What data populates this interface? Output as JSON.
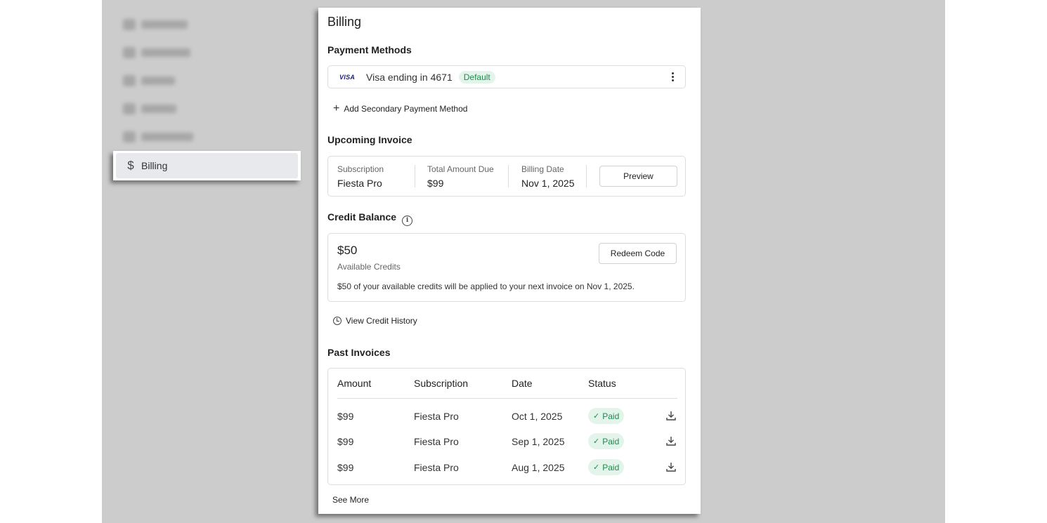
{
  "sidebar": {
    "billing_label": "Billing"
  },
  "panel": {
    "title": "Billing"
  },
  "payment_methods": {
    "title": "Payment Methods",
    "card_brand": "VISA",
    "card_label": "Visa ending in 4671",
    "default_badge": "Default",
    "add_label": "Add Secondary Payment Method"
  },
  "upcoming_invoice": {
    "title": "Upcoming Invoice",
    "subscription_label": "Subscription",
    "subscription_value": "Fiesta Pro",
    "amount_label": "Total Amount Due",
    "amount_value": "$99",
    "date_label": "Billing Date",
    "date_value": "Nov 1, 2025",
    "preview_label": "Preview"
  },
  "credit_balance": {
    "title": "Credit Balance",
    "amount": "$50",
    "sub": "Available Credits",
    "redeem_label": "Redeem Code",
    "note": "$50 of your available credits will be applied to your next invoice on Nov 1, 2025.",
    "history_label": "View Credit History"
  },
  "past_invoices": {
    "title": "Past Invoices",
    "columns": [
      "Amount",
      "Subscription",
      "Date",
      "Status"
    ],
    "rows": [
      {
        "amount": "$99",
        "subscription": "Fiesta Pro",
        "date": "Oct 1, 2025",
        "status": "Paid"
      },
      {
        "amount": "$99",
        "subscription": "Fiesta Pro",
        "date": "Sep 1, 2025",
        "status": "Paid"
      },
      {
        "amount": "$99",
        "subscription": "Fiesta Pro",
        "date": "Aug 1, 2025",
        "status": "Paid"
      }
    ],
    "see_more_label": "See More"
  },
  "colors": {
    "success_bg": "#e3f5ea",
    "success_text": "#1e8a4c",
    "backdrop": "#cccccc"
  }
}
